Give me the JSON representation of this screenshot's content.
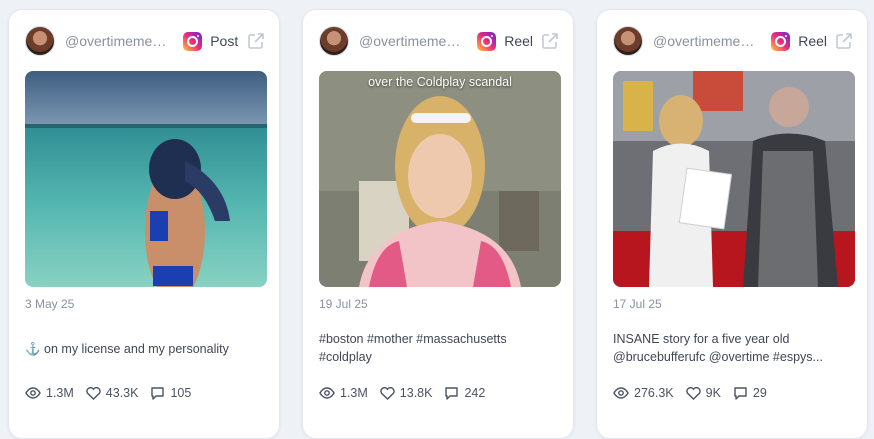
{
  "cards": [
    {
      "handle": "@overtimemeg...",
      "platform_icon": "instagram-icon",
      "post_type": "Post",
      "date": "3 May 25",
      "caption_lines": [
        "⚓ on my license and my personality"
      ],
      "stats": {
        "views": "1.3M",
        "likes": "43.3K",
        "comments": "105"
      }
    },
    {
      "handle": "@overtimemeg...",
      "platform_icon": "instagram-icon",
      "post_type": "Reel",
      "date": "19 Jul 25",
      "media_overlay": "over the Coldplay scandal",
      "caption_lines": [
        "#boston #mother #massachusetts",
        "#coldplay"
      ],
      "stats": {
        "views": "1.3M",
        "likes": "13.8K",
        "comments": "242"
      }
    },
    {
      "handle": "@overtimemeg...",
      "platform_icon": "instagram-icon",
      "post_type": "Reel",
      "date": "17 Jul 25",
      "caption_lines": [
        "INSANE story for a five year old",
        "@brucebufferufc @overtime #espys..."
      ],
      "stats": {
        "views": "276.3K",
        "likes": "9K",
        "comments": "29"
      }
    }
  ],
  "colors": {
    "accent_text": "#3f4654",
    "muted_text": "#8a90a0",
    "card_bg": "#ffffff",
    "page_bg": "#eef1f6"
  }
}
